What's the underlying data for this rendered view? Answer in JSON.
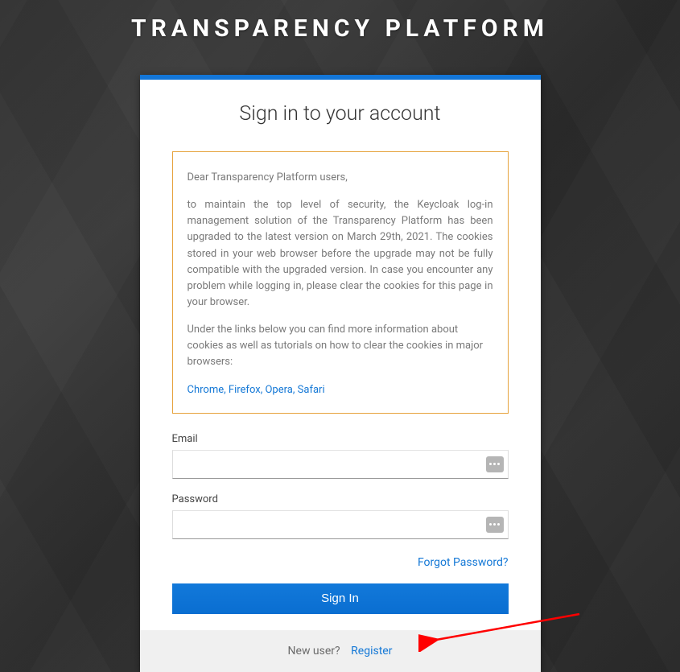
{
  "page_title": "TRANSPARENCY PLATFORM",
  "card": {
    "heading": "Sign in to your account",
    "notice": {
      "greeting": "Dear Transparency Platform users,",
      "para1": "to maintain the top level of security, the Keycloak log-in management solution of the Transparency Platform has been upgraded to the latest version on March 29th, 2021. The cookies stored in your web browser before the upgrade may not be fully compatible with the upgraded version. In case you encounter any problem while logging in, please clear the cookies for this page in your browser.",
      "para2": "Under the links below you can find more information about cookies as well as tutorials on how to clear the cookies in major browsers:",
      "links": {
        "chrome": "Chrome",
        "firefox": "Firefox",
        "opera": "Opera",
        "safari": "Safari"
      }
    },
    "form": {
      "email_label": "Email",
      "email_value": "",
      "password_label": "Password",
      "password_value": "",
      "forgot": "Forgot Password?",
      "signin": "Sign In"
    },
    "footer": {
      "new_user": "New user?",
      "register": "Register"
    }
  },
  "colors": {
    "accent": "#1376d8",
    "notice_border": "#e6a23c",
    "annotation": "#ff0000"
  }
}
